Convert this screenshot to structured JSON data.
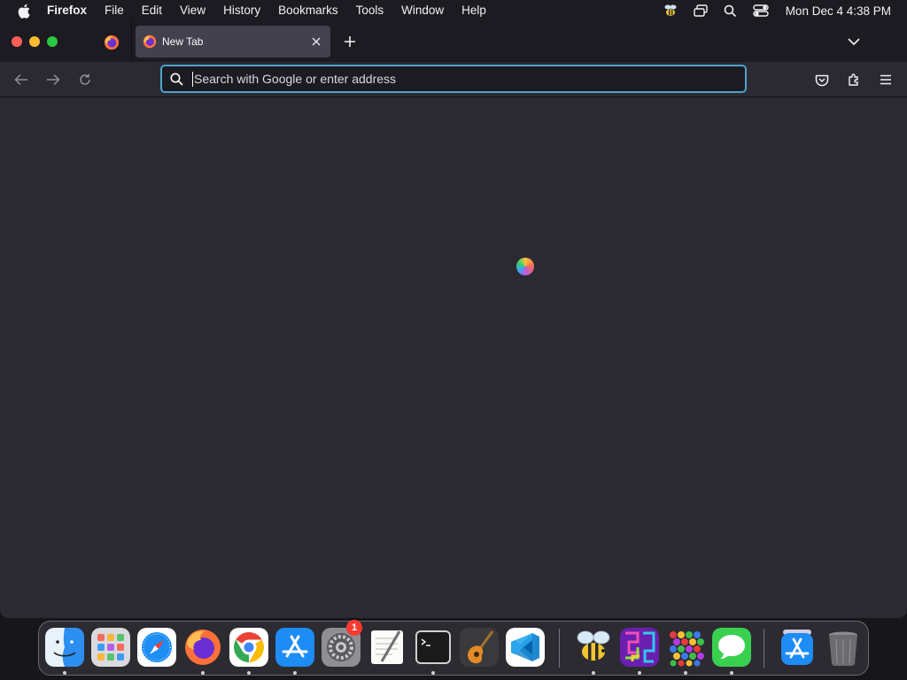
{
  "menubar": {
    "app_name": "Firefox",
    "items": [
      "File",
      "Edit",
      "View",
      "History",
      "Bookmarks",
      "Tools",
      "Window",
      "Help"
    ],
    "clock": "Mon Dec 4  4:38 PM"
  },
  "tabs": [
    {
      "title": "New Tab",
      "active": true
    }
  ],
  "urlbar": {
    "placeholder": "Search with Google or enter address",
    "value": ""
  },
  "dock": {
    "apps": [
      {
        "name": "Finder",
        "icon": "finder-icon",
        "running": true
      },
      {
        "name": "Launchpad",
        "icon": "launchpad-icon",
        "running": false
      },
      {
        "name": "Safari",
        "icon": "safari-icon",
        "running": false
      },
      {
        "name": "Firefox",
        "icon": "firefox-icon",
        "running": true
      },
      {
        "name": "Google Chrome",
        "icon": "chrome-icon",
        "running": true
      },
      {
        "name": "App Store",
        "icon": "app-store-icon",
        "running": true
      },
      {
        "name": "System Preferences",
        "icon": "system-preferences-icon",
        "running": false,
        "badge": "1"
      },
      {
        "name": "TextEdit",
        "icon": "textedit-icon",
        "running": false
      },
      {
        "name": "Terminal",
        "icon": "terminal-icon",
        "running": true
      },
      {
        "name": "GarageBand",
        "icon": "garageband-icon",
        "running": false
      },
      {
        "name": "Visual Studio Code",
        "icon": "vscode-icon",
        "running": false
      },
      {
        "name": "Bee Game",
        "icon": "bee-icon",
        "running": true
      },
      {
        "name": "Maze Game",
        "icon": "maze-icon",
        "running": true
      },
      {
        "name": "Bubble Game",
        "icon": "bubbles-icon",
        "running": true
      },
      {
        "name": "Messages",
        "icon": "messages-icon",
        "running": true
      },
      {
        "name": "App Store Downloads",
        "icon": "downloads-icon",
        "running": false
      },
      {
        "name": "Trash",
        "icon": "trash-icon",
        "running": false
      }
    ]
  },
  "colors": {
    "accent": "#4aa5c9",
    "toolbar": "#2b2a33",
    "tabstrip": "#1c1b22",
    "active_tab": "#42414d"
  }
}
